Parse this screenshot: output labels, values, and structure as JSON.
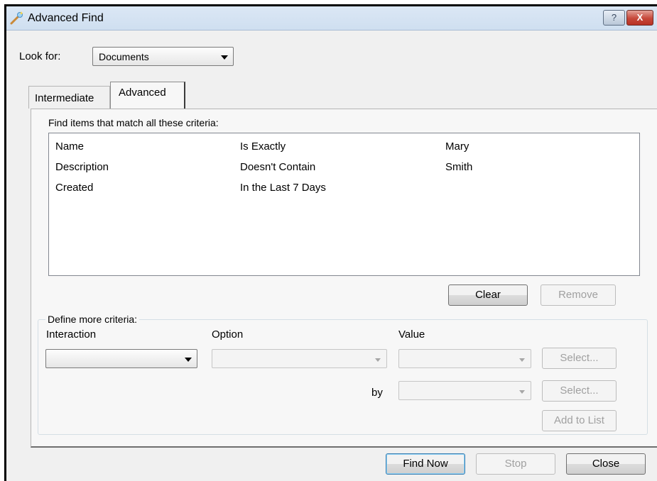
{
  "window": {
    "title": "Advanced Find",
    "help_label": "?",
    "close_label": "X"
  },
  "look_for": {
    "label": "Look for:",
    "value": "Documents"
  },
  "tabs": [
    {
      "label": "Intermediate"
    },
    {
      "label": "Advanced"
    }
  ],
  "criteria": {
    "heading": "Find items that match all these criteria:",
    "rows": [
      {
        "field": "Name",
        "condition": "Is Exactly",
        "value": "Mary"
      },
      {
        "field": "Description",
        "condition": "Doesn't Contain",
        "value": "Smith"
      },
      {
        "field": "Created",
        "condition": "In the Last 7 Days",
        "value": ""
      }
    ],
    "clear_label": "Clear",
    "remove_label": "Remove"
  },
  "define_more": {
    "group_title": "Define more criteria:",
    "interaction_label": "Interaction",
    "option_label": "Option",
    "value_label": "Value",
    "by_label": "by",
    "select_label_1": "Select...",
    "select_label_2": "Select...",
    "add_to_list_label": "Add to List"
  },
  "footer": {
    "find_now_label": "Find Now",
    "stop_label": "Stop",
    "close_label": "Close"
  }
}
